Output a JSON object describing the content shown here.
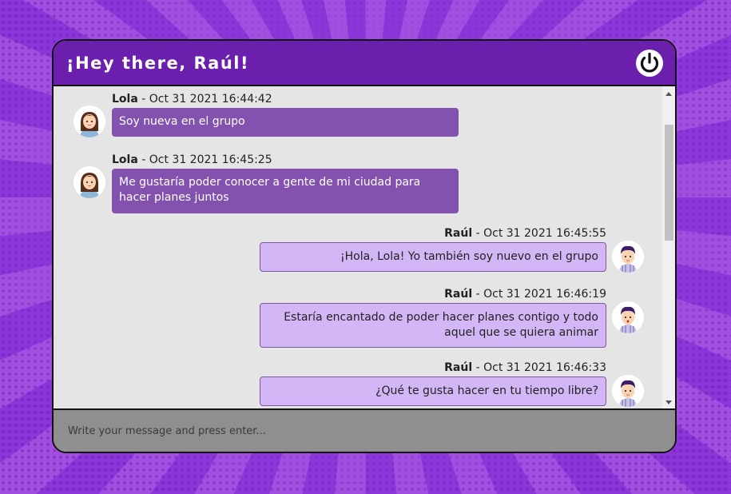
{
  "header": {
    "title": "¡Hey there, Raúl!",
    "power_icon": "power-icon"
  },
  "messages": [
    {
      "side": "left",
      "author": "Lola",
      "timestamp": " - Oct 31 2021 16:44:42",
      "text": "Soy nueva en el grupo",
      "avatar": "female-avatar"
    },
    {
      "side": "left",
      "author": "Lola",
      "timestamp": " - Oct 31 2021 16:45:25",
      "text": "Me gustaría poder conocer a gente de mi ciudad para hacer planes juntos",
      "avatar": "female-avatar"
    },
    {
      "side": "right",
      "author": "Raúl",
      "timestamp": " - Oct 31 2021 16:45:55",
      "text": "¡Hola, Lola! Yo también soy nuevo en el grupo",
      "avatar": "male-avatar"
    },
    {
      "side": "right",
      "author": "Raúl",
      "timestamp": " - Oct 31 2021 16:46:19",
      "text": "Estaría encantado de poder hacer planes contigo y todo aquel que se quiera animar",
      "avatar": "male-avatar"
    },
    {
      "side": "right",
      "author": "Raúl",
      "timestamp": " - Oct 31 2021 16:46:33",
      "text": "¿Qué te gusta hacer en tu tiempo libre?",
      "avatar": "male-avatar"
    }
  ],
  "input": {
    "placeholder": "Write your message and press enter...",
    "value": ""
  },
  "colors": {
    "header": "#6a1fad",
    "incoming_bubble": "#8351ae",
    "outgoing_bubble": "#d3b6f5",
    "chat_background": "#e5e5e5",
    "input_bar": "#8f8f8f"
  }
}
